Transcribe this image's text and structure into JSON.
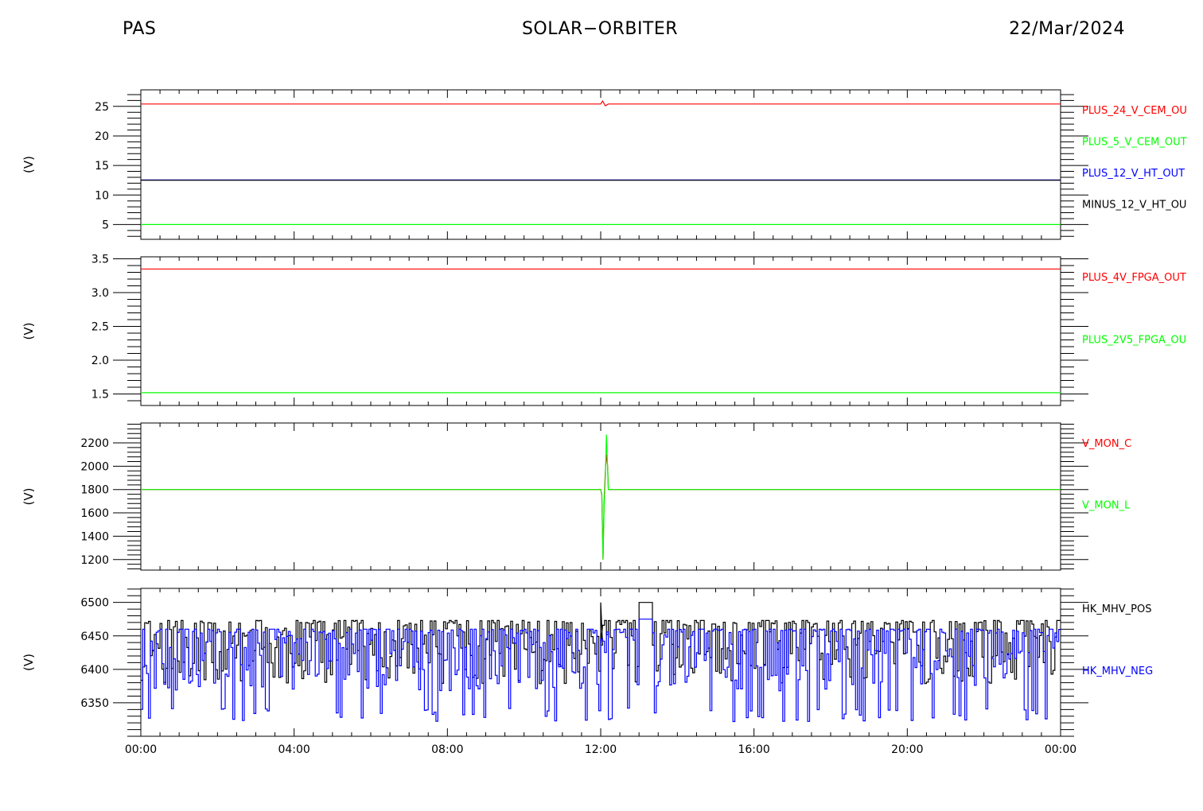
{
  "header": {
    "instrument": "PAS",
    "mission": "SOLAR−ORBITER",
    "date": "22/Mar/2024"
  },
  "chart_data": {
    "type": "line",
    "x_tick_labels": [
      "00:00",
      "04:00",
      "08:00",
      "12:00",
      "16:00",
      "20:00",
      "00:00"
    ],
    "x_range_hours": [
      0,
      24
    ],
    "panels": [
      {
        "ylabel": "(V)",
        "ylim": [
          2.5,
          27.8
        ],
        "ytick_values": [
          5,
          10,
          15,
          20,
          25
        ],
        "ytick_labels": [
          "5",
          "10",
          "15",
          "20",
          "25"
        ],
        "series": [
          {
            "name": "PLUS_24_V_CEM_OUT",
            "label_text": "PLUS_24_V_CEM_OU",
            "color": "#ff0000",
            "x": [
              0,
              12.0,
              12.05,
              12.12,
              12.2,
              24
            ],
            "y": [
              25.4,
              25.4,
              25.9,
              25.1,
              25.4,
              25.4
            ]
          },
          {
            "name": "PLUS_5_V_CEM_OUT",
            "label_text": "PLUS_5_V_CEM_OUT",
            "color": "#00ff00",
            "x": [
              0,
              24
            ],
            "y": [
              5.0,
              5.0
            ]
          },
          {
            "name": "PLUS_12_V_HT_OUT",
            "label_text": "PLUS_12_V_HT_OUT",
            "color": "#0000ff",
            "x": [
              0,
              24
            ],
            "y": [
              12.55,
              12.55
            ]
          },
          {
            "name": "MINUS_12_V_HT_OUT",
            "label_text": "MINUS_12_V_HT_OU",
            "color": "#000000",
            "x": [
              0,
              24
            ],
            "y": [
              12.5,
              12.5
            ]
          }
        ]
      },
      {
        "ylabel": "(V)",
        "ylim": [
          1.33,
          3.53
        ],
        "ytick_values": [
          1.5,
          2.0,
          2.5,
          3.0,
          3.5
        ],
        "ytick_labels": [
          "1.5",
          "2.0",
          "2.5",
          "3.0",
          "3.5"
        ],
        "series": [
          {
            "name": "PLUS_4V_FPGA_OUT",
            "label_text": "PLUS_4V_FPGA_OUT",
            "color": "#ff0000",
            "x": [
              0,
              24
            ],
            "y": [
              3.35,
              3.35
            ]
          },
          {
            "name": "PLUS_2V5_FPGA_OUT",
            "label_text": "PLUS_2V5_FPGA_OU",
            "color": "#00ff00",
            "x": [
              0,
              24
            ],
            "y": [
              1.52,
              1.52
            ]
          }
        ]
      },
      {
        "ylabel": "(V)",
        "ylim": [
          1110,
          2370
        ],
        "ytick_values": [
          1200,
          1400,
          1600,
          1800,
          2000,
          2200
        ],
        "ytick_labels": [
          "1200",
          "1400",
          "1600",
          "1800",
          "2000",
          "2200"
        ],
        "series": [
          {
            "name": "V_MON_C",
            "label_text": "V_MON_C",
            "color": "#ff0000",
            "x": [
              0,
              12.0,
              12.03,
              12.06,
              12.09,
              12.12,
              12.15,
              12.18,
              12.2,
              24
            ],
            "y": [
              1800,
              1800,
              1750,
              1200,
              1700,
              1950,
              2100,
              2000,
              1800,
              1800
            ]
          },
          {
            "name": "V_MON_L",
            "label_text": "V_MON_L",
            "color": "#00ff00",
            "x": [
              0,
              12.0,
              12.03,
              12.06,
              12.09,
              12.12,
              12.15,
              12.18,
              12.2,
              24
            ],
            "y": [
              1800,
              1800,
              1760,
              1200,
              1650,
              1900,
              2270,
              1980,
              1800,
              1800
            ]
          }
        ]
      },
      {
        "ylabel": "(V)",
        "ylim": [
          6300,
          6521
        ],
        "ytick_values": [
          6350,
          6400,
          6450,
          6500
        ],
        "ytick_labels": [
          "6350",
          "6400",
          "6450",
          "6500"
        ],
        "series": [
          {
            "name": "HK_MHV_POS",
            "label_text": "HK_MHV_POS",
            "color": "#000000",
            "noisy": true,
            "seed": 11,
            "baseline": 6440,
            "high": 6473,
            "low": 6378,
            "step_hours": 0.05,
            "plateau": {
              "x": [
                12.98,
                13.32
              ],
              "y": 6500
            },
            "spike": {
              "x": 12.0,
              "y": 6500
            }
          },
          {
            "name": "HK_MHV_NEG",
            "label_text": "HK_MHV_NEG",
            "color": "#0000ff",
            "noisy": true,
            "seed": 29,
            "baseline": 6430,
            "high": 6460,
            "low": 6322,
            "step_hours": 0.05,
            "plateau": {
              "x": [
                12.98,
                13.32
              ],
              "y": 6475
            }
          }
        ]
      }
    ]
  }
}
